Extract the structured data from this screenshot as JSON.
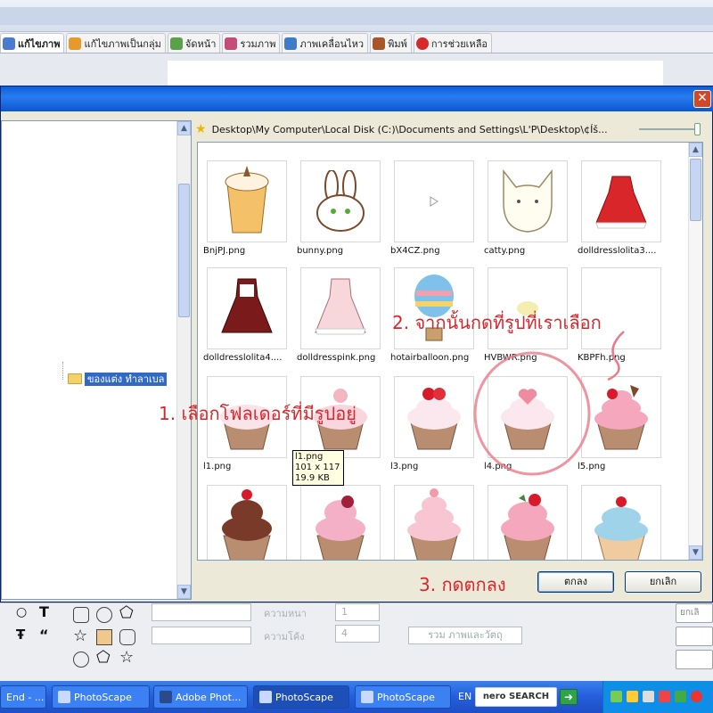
{
  "app": {
    "tabs": [
      {
        "label": "แก้ไขภาพ",
        "color": "#4a7bd0"
      },
      {
        "label": "แก้ไขภาพเป็นกลุ่ม",
        "color": "#e59a2b"
      },
      {
        "label": "จัดหน้า",
        "color": "#5aa24a"
      },
      {
        "label": "รวมภาพ",
        "color": "#c44b7a"
      },
      {
        "label": "ภาพเคลื่อนไหว",
        "color": "#3e7cc7"
      },
      {
        "label": "พิมพ์",
        "color": "#a8552a"
      },
      {
        "label": "การช่วยเหลือ",
        "color": "#d62a2a"
      }
    ]
  },
  "dialog": {
    "close_glyph": "✕",
    "tree_selected_folder": "ของแต่ง ทำลาเบล",
    "path": "Desktop\\My Computer\\Local Disk (C:)\\Documents and Settings\\L'P\\Desktop\\¢Íš...",
    "files": [
      {
        "name": "BnjPJ.png"
      },
      {
        "name": "bunny.png"
      },
      {
        "name": "bX4CZ.png"
      },
      {
        "name": "catty.png"
      },
      {
        "name": "dolldresslolita3...."
      },
      {
        "name": "dolldresslolita4...."
      },
      {
        "name": "dolldresspink.png"
      },
      {
        "name": "hotairballoon.png"
      },
      {
        "name": "HVBWR.png"
      },
      {
        "name": "KBPFh.png"
      },
      {
        "name": "l1.png"
      },
      {
        "name": ""
      },
      {
        "name": "l3.png"
      },
      {
        "name": "l4.png"
      },
      {
        "name": "l5.png"
      }
    ],
    "tooltip": {
      "name": "l1.png",
      "size": "101 x 117",
      "filesize": "19.9 KB"
    },
    "ok_label": "ตกลง",
    "cancel_label": "ยกเลิก"
  },
  "annotations": {
    "step1": "1. เลือกโฟลเดอร์ที่มีรูปอยู่",
    "step2": "2. จากนั้นกดที่รูปที่เราเลือก",
    "step3": "3. กดตกลง"
  },
  "bottom": {
    "thickness_label": "ความหนา",
    "thickness_value": "1",
    "curve_label": "ความโค้ง",
    "curve_value": "4",
    "merge_button": "รวม ภาพและวัตถุ",
    "cancel_side": "ยกเลิ"
  },
  "taskbar": {
    "tasks": [
      "End - ...",
      "PhotoScape",
      "Adobe Phot...",
      "PhotoScape",
      "PhotoScape"
    ],
    "lang": "EN",
    "nero": "nero SEARCH"
  }
}
